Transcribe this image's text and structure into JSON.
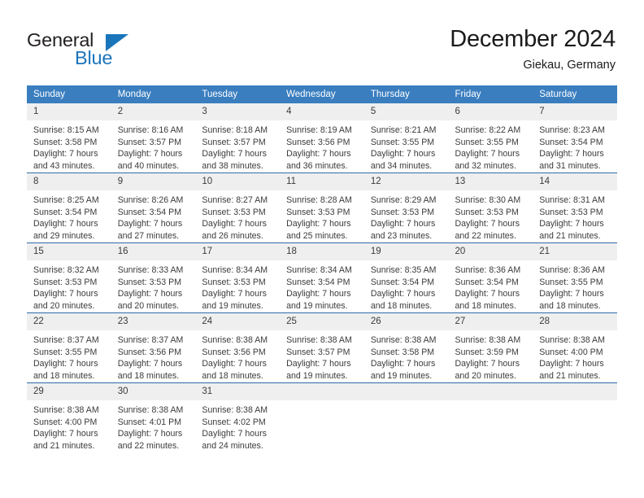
{
  "logo": {
    "word_top": "General",
    "word_bottom": "Blue",
    "triangle_icon": "blue-triangle-icon",
    "accent_color": "#1b75bb"
  },
  "header": {
    "title": "December 2024",
    "subtitle": "Giekau, Germany"
  },
  "theme": {
    "header_blue": "#3a7ebf",
    "rule_blue": "#2e6ca8",
    "daynum_band": "#efefef",
    "text": "#3b3b3b"
  },
  "calendar": {
    "weekdays": [
      "Sunday",
      "Monday",
      "Tuesday",
      "Wednesday",
      "Thursday",
      "Friday",
      "Saturday"
    ],
    "weeks": [
      [
        {
          "day": "1",
          "sunrise": "Sunrise: 8:15 AM",
          "sunset": "Sunset: 3:58 PM",
          "daylight_line1": "Daylight: 7 hours",
          "daylight_line2": "and 43 minutes."
        },
        {
          "day": "2",
          "sunrise": "Sunrise: 8:16 AM",
          "sunset": "Sunset: 3:57 PM",
          "daylight_line1": "Daylight: 7 hours",
          "daylight_line2": "and 40 minutes."
        },
        {
          "day": "3",
          "sunrise": "Sunrise: 8:18 AM",
          "sunset": "Sunset: 3:57 PM",
          "daylight_line1": "Daylight: 7 hours",
          "daylight_line2": "and 38 minutes."
        },
        {
          "day": "4",
          "sunrise": "Sunrise: 8:19 AM",
          "sunset": "Sunset: 3:56 PM",
          "daylight_line1": "Daylight: 7 hours",
          "daylight_line2": "and 36 minutes."
        },
        {
          "day": "5",
          "sunrise": "Sunrise: 8:21 AM",
          "sunset": "Sunset: 3:55 PM",
          "daylight_line1": "Daylight: 7 hours",
          "daylight_line2": "and 34 minutes."
        },
        {
          "day": "6",
          "sunrise": "Sunrise: 8:22 AM",
          "sunset": "Sunset: 3:55 PM",
          "daylight_line1": "Daylight: 7 hours",
          "daylight_line2": "and 32 minutes."
        },
        {
          "day": "7",
          "sunrise": "Sunrise: 8:23 AM",
          "sunset": "Sunset: 3:54 PM",
          "daylight_line1": "Daylight: 7 hours",
          "daylight_line2": "and 31 minutes."
        }
      ],
      [
        {
          "day": "8",
          "sunrise": "Sunrise: 8:25 AM",
          "sunset": "Sunset: 3:54 PM",
          "daylight_line1": "Daylight: 7 hours",
          "daylight_line2": "and 29 minutes."
        },
        {
          "day": "9",
          "sunrise": "Sunrise: 8:26 AM",
          "sunset": "Sunset: 3:54 PM",
          "daylight_line1": "Daylight: 7 hours",
          "daylight_line2": "and 27 minutes."
        },
        {
          "day": "10",
          "sunrise": "Sunrise: 8:27 AM",
          "sunset": "Sunset: 3:53 PM",
          "daylight_line1": "Daylight: 7 hours",
          "daylight_line2": "and 26 minutes."
        },
        {
          "day": "11",
          "sunrise": "Sunrise: 8:28 AM",
          "sunset": "Sunset: 3:53 PM",
          "daylight_line1": "Daylight: 7 hours",
          "daylight_line2": "and 25 minutes."
        },
        {
          "day": "12",
          "sunrise": "Sunrise: 8:29 AM",
          "sunset": "Sunset: 3:53 PM",
          "daylight_line1": "Daylight: 7 hours",
          "daylight_line2": "and 23 minutes."
        },
        {
          "day": "13",
          "sunrise": "Sunrise: 8:30 AM",
          "sunset": "Sunset: 3:53 PM",
          "daylight_line1": "Daylight: 7 hours",
          "daylight_line2": "and 22 minutes."
        },
        {
          "day": "14",
          "sunrise": "Sunrise: 8:31 AM",
          "sunset": "Sunset: 3:53 PM",
          "daylight_line1": "Daylight: 7 hours",
          "daylight_line2": "and 21 minutes."
        }
      ],
      [
        {
          "day": "15",
          "sunrise": "Sunrise: 8:32 AM",
          "sunset": "Sunset: 3:53 PM",
          "daylight_line1": "Daylight: 7 hours",
          "daylight_line2": "and 20 minutes."
        },
        {
          "day": "16",
          "sunrise": "Sunrise: 8:33 AM",
          "sunset": "Sunset: 3:53 PM",
          "daylight_line1": "Daylight: 7 hours",
          "daylight_line2": "and 20 minutes."
        },
        {
          "day": "17",
          "sunrise": "Sunrise: 8:34 AM",
          "sunset": "Sunset: 3:53 PM",
          "daylight_line1": "Daylight: 7 hours",
          "daylight_line2": "and 19 minutes."
        },
        {
          "day": "18",
          "sunrise": "Sunrise: 8:34 AM",
          "sunset": "Sunset: 3:54 PM",
          "daylight_line1": "Daylight: 7 hours",
          "daylight_line2": "and 19 minutes."
        },
        {
          "day": "19",
          "sunrise": "Sunrise: 8:35 AM",
          "sunset": "Sunset: 3:54 PM",
          "daylight_line1": "Daylight: 7 hours",
          "daylight_line2": "and 18 minutes."
        },
        {
          "day": "20",
          "sunrise": "Sunrise: 8:36 AM",
          "sunset": "Sunset: 3:54 PM",
          "daylight_line1": "Daylight: 7 hours",
          "daylight_line2": "and 18 minutes."
        },
        {
          "day": "21",
          "sunrise": "Sunrise: 8:36 AM",
          "sunset": "Sunset: 3:55 PM",
          "daylight_line1": "Daylight: 7 hours",
          "daylight_line2": "and 18 minutes."
        }
      ],
      [
        {
          "day": "22",
          "sunrise": "Sunrise: 8:37 AM",
          "sunset": "Sunset: 3:55 PM",
          "daylight_line1": "Daylight: 7 hours",
          "daylight_line2": "and 18 minutes."
        },
        {
          "day": "23",
          "sunrise": "Sunrise: 8:37 AM",
          "sunset": "Sunset: 3:56 PM",
          "daylight_line1": "Daylight: 7 hours",
          "daylight_line2": "and 18 minutes."
        },
        {
          "day": "24",
          "sunrise": "Sunrise: 8:38 AM",
          "sunset": "Sunset: 3:56 PM",
          "daylight_line1": "Daylight: 7 hours",
          "daylight_line2": "and 18 minutes."
        },
        {
          "day": "25",
          "sunrise": "Sunrise: 8:38 AM",
          "sunset": "Sunset: 3:57 PM",
          "daylight_line1": "Daylight: 7 hours",
          "daylight_line2": "and 19 minutes."
        },
        {
          "day": "26",
          "sunrise": "Sunrise: 8:38 AM",
          "sunset": "Sunset: 3:58 PM",
          "daylight_line1": "Daylight: 7 hours",
          "daylight_line2": "and 19 minutes."
        },
        {
          "day": "27",
          "sunrise": "Sunrise: 8:38 AM",
          "sunset": "Sunset: 3:59 PM",
          "daylight_line1": "Daylight: 7 hours",
          "daylight_line2": "and 20 minutes."
        },
        {
          "day": "28",
          "sunrise": "Sunrise: 8:38 AM",
          "sunset": "Sunset: 4:00 PM",
          "daylight_line1": "Daylight: 7 hours",
          "daylight_line2": "and 21 minutes."
        }
      ],
      [
        {
          "day": "29",
          "sunrise": "Sunrise: 8:38 AM",
          "sunset": "Sunset: 4:00 PM",
          "daylight_line1": "Daylight: 7 hours",
          "daylight_line2": "and 21 minutes."
        },
        {
          "day": "30",
          "sunrise": "Sunrise: 8:38 AM",
          "sunset": "Sunset: 4:01 PM",
          "daylight_line1": "Daylight: 7 hours",
          "daylight_line2": "and 22 minutes."
        },
        {
          "day": "31",
          "sunrise": "Sunrise: 8:38 AM",
          "sunset": "Sunset: 4:02 PM",
          "daylight_line1": "Daylight: 7 hours",
          "daylight_line2": "and 24 minutes."
        },
        {
          "day": "",
          "sunrise": "",
          "sunset": "",
          "daylight_line1": "",
          "daylight_line2": ""
        },
        {
          "day": "",
          "sunrise": "",
          "sunset": "",
          "daylight_line1": "",
          "daylight_line2": ""
        },
        {
          "day": "",
          "sunrise": "",
          "sunset": "",
          "daylight_line1": "",
          "daylight_line2": ""
        },
        {
          "day": "",
          "sunrise": "",
          "sunset": "",
          "daylight_line1": "",
          "daylight_line2": ""
        }
      ]
    ]
  }
}
